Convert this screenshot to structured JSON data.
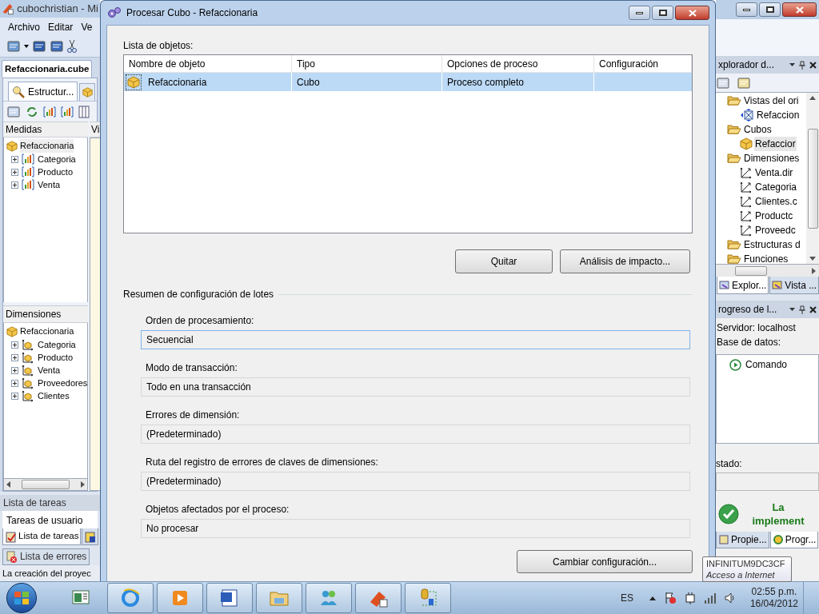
{
  "app": {
    "title": "cubochristian - Mi",
    "menu": [
      "Archivo",
      "Editar",
      "Ve"
    ],
    "document_tab": "Refaccionaria.cube",
    "designer_tab": "Estructur...",
    "view_strip": "Vi"
  },
  "measures": {
    "header": "Medidas",
    "root": {
      "label": "Refaccionaria",
      "selected": true
    },
    "groups": [
      {
        "label": "Categoria",
        "expanded": false
      },
      {
        "label": "Producto",
        "expanded": false
      },
      {
        "label": "Venta",
        "expanded": false
      }
    ]
  },
  "dimensions": {
    "header": "Dimensiones",
    "root": {
      "label": "Refaccionaria",
      "selected": false
    },
    "items": [
      {
        "label": "Categoria",
        "expanded": false
      },
      {
        "label": "Producto",
        "expanded": false
      },
      {
        "label": "Venta",
        "expanded": false
      },
      {
        "label": "Proveedores",
        "expanded": false
      },
      {
        "label": "Clientes",
        "expanded": false
      }
    ]
  },
  "task_list": {
    "header": "Lista de tareas",
    "filter": "Tareas de usuario",
    "tabs": [
      {
        "label": "Lista de tareas",
        "selected": true
      },
      {
        "selected": false
      }
    ],
    "error_tab": "Lista de errores",
    "status": "La creación del proyec"
  },
  "dialog": {
    "title": "Procesar Cubo - Refaccionaria",
    "list_label": "Lista de objetos:",
    "columns": [
      "Nombre de objeto",
      "Tipo",
      "Opciones de proceso",
      "Configuración"
    ],
    "rows": [
      {
        "name": "Refaccionaria",
        "type": "Cubo",
        "options": "Proceso completo",
        "selected": true
      }
    ],
    "buttons": [
      "Quitar",
      "Análisis de impacto..."
    ],
    "group_title": "Resumen de configuración de lotes",
    "settings": [
      {
        "label": "Orden de procesamiento:",
        "value": "Secuencial",
        "focused": true
      },
      {
        "label": "Modo de transacción:",
        "value": "Todo en una transacción",
        "focused": false
      },
      {
        "label": "Errores de dimensión:",
        "value": "(Predeterminado)",
        "focused": false
      },
      {
        "label": "Ruta del registro de errores de claves de dimensiones:",
        "value": "(Predeterminado)",
        "focused": false
      },
      {
        "label": "Objetos afectados por el proceso:",
        "value": "No procesar",
        "focused": false
      }
    ],
    "change_button": "Cambiar configuración..."
  },
  "explorer": {
    "title": "xplorador d...",
    "tree": [
      {
        "label": "Vistas del ori",
        "kind": "folder",
        "selected": false,
        "children": [
          {
            "label": "Refaccion",
            "kind": "view",
            "selected": false
          }
        ]
      },
      {
        "label": "Cubos",
        "kind": "folder",
        "selected": false,
        "children": [
          {
            "label": "Refaccior",
            "kind": "cube",
            "selected": true
          }
        ]
      },
      {
        "label": "Dimensiones",
        "kind": "folder",
        "selected": false,
        "children": [
          {
            "label": "Venta.dir",
            "kind": "dimension",
            "selected": false
          },
          {
            "label": "Categoria",
            "kind": "dimension",
            "selected": false
          },
          {
            "label": "Clientes.c",
            "kind": "dimension",
            "selected": false
          },
          {
            "label": "Productc",
            "kind": "dimension",
            "selected": false
          },
          {
            "label": "Proveedc",
            "kind": "dimension",
            "selected": false
          }
        ]
      },
      {
        "label": "Estructuras d",
        "kind": "folder",
        "selected": false
      },
      {
        "label": "Funciones",
        "kind": "folder",
        "selected": false
      }
    ],
    "tabs": [
      {
        "label": "Explor...",
        "selected": true
      },
      {
        "label": "Vista ...",
        "selected": false
      }
    ]
  },
  "progress": {
    "title": "rogreso de l...",
    "server": "Servidor: localhost",
    "database": "Base de datos:",
    "commands": [
      "Comando"
    ],
    "status_label": "stado:",
    "result": "La implement",
    "tabs": [
      {
        "label": "Propie...",
        "selected": false
      },
      {
        "label": "Progr...",
        "selected": true
      }
    ]
  },
  "tooltip": {
    "title": "INFINITUM9DC3CF",
    "subtitle": "Acceso a Internet"
  },
  "taskbar": {
    "language": "ES",
    "time": "02:55 p.m.",
    "date": "16/04/2012"
  }
}
